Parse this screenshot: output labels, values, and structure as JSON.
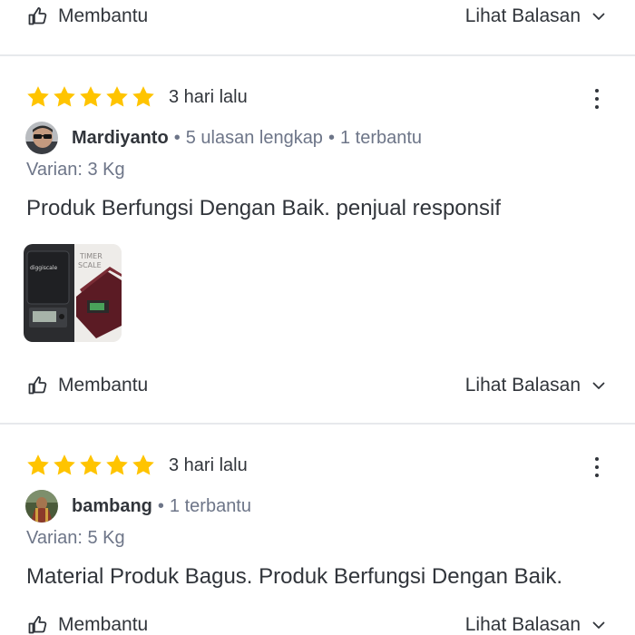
{
  "top_actions": {
    "helpful_label": "Membantu",
    "see_replies_label": "Lihat Balasan"
  },
  "reviews": [
    {
      "rating": 5,
      "time_ago": "3 hari lalu",
      "username": "Mardiyanto",
      "reviews_count": "5 ulasan lengkap",
      "helpful_count": "1 terbantu",
      "variant": "Varian: 3 Kg",
      "text": "Produk Berfungsi Dengan Baik. penjual responsif",
      "photo_text": {
        "brand": "diggiscale",
        "label_line1": "TIMER",
        "label_line2": "SCALE"
      },
      "helpful_label": "Membantu",
      "see_replies_label": "Lihat Balasan"
    },
    {
      "rating": 5,
      "time_ago": "3 hari lalu",
      "username": "bambang",
      "helpful_count": "1 terbantu",
      "variant": "Varian: 5 Kg",
      "text": "Material Produk Bagus. Produk Berfungsi Dengan Baik.",
      "helpful_label": "Membantu",
      "see_replies_label": "Lihat Balasan"
    }
  ],
  "colors": {
    "star": "#ffc400",
    "text_primary": "#31353b",
    "text_secondary": "#6d7588",
    "divider": "#e7e9ec"
  },
  "icons": {
    "helpful": "thumbs-up-outline-icon",
    "expand": "chevron-down-icon",
    "more": "more-vertical-icon",
    "star": "star-icon"
  }
}
